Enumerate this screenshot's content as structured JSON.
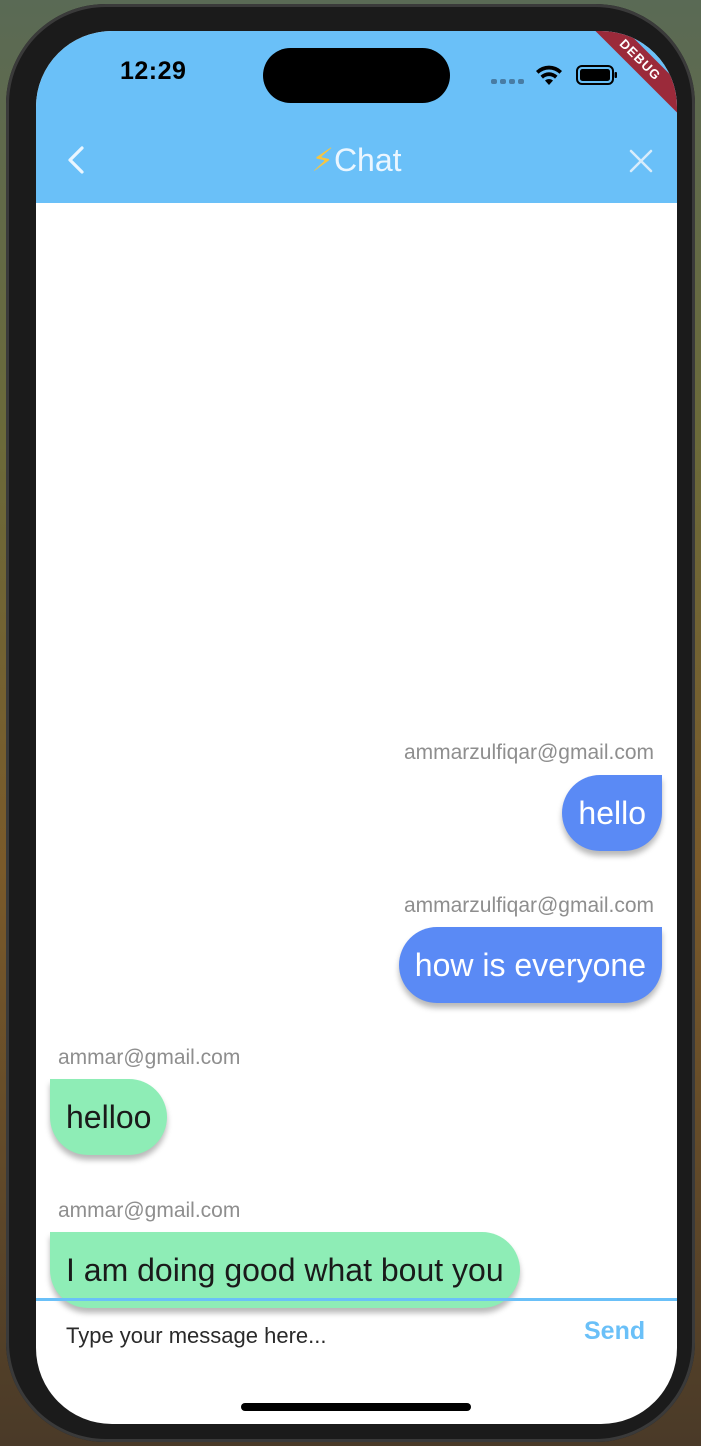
{
  "status_bar": {
    "time": "12:29"
  },
  "debug_banner": "DEBUG",
  "nav": {
    "title_icon": "⚡",
    "title": "Chat",
    "back_icon": "chevron-left-icon",
    "close_icon": "close-icon"
  },
  "messages": [
    {
      "sender": "ammarzulfiqar@gmail.com",
      "text": "hello",
      "is_me": true
    },
    {
      "sender": "ammarzulfiqar@gmail.com",
      "text": "how is everyone",
      "is_me": true
    },
    {
      "sender": "ammar@gmail.com",
      "text": "helloo",
      "is_me": false
    },
    {
      "sender": "ammar@gmail.com",
      "text": "I am doing good what bout you",
      "is_me": false
    }
  ],
  "composer": {
    "placeholder": "Type your message here...",
    "send_label": "Send"
  },
  "colors": {
    "app_bar": "#6ac0f8",
    "my_bubble": "#5a8af5",
    "other_bubble": "#8eedb6",
    "sender_text": "#8e8e8e",
    "send_button": "#6ac0f8"
  }
}
